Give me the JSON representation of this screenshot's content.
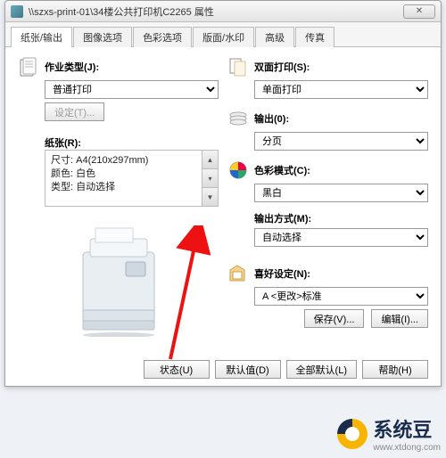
{
  "window": {
    "title": "\\\\szxs-print-01\\34楼公共打印机C2265 属性"
  },
  "tabs": [
    "纸张/输出",
    "图像选项",
    "色彩选项",
    "版面/水印",
    "高级",
    "传真"
  ],
  "left": {
    "jobtype_label": "作业类型(J):",
    "jobtype_value": "普通打印",
    "settings_btn": "设定(T)...",
    "paper_label": "纸张(R):",
    "paper_size_k": "尺寸:",
    "paper_size_v": "A4(210x297mm)",
    "paper_color_k": "颜色:",
    "paper_color_v": "白色",
    "paper_type_k": "类型:",
    "paper_type_v": "自动选择"
  },
  "right": {
    "duplex_label": "双面打印(S):",
    "duplex_value": "单面打印",
    "output_label": "输出(0):",
    "output_value": "分页",
    "color_label": "色彩模式(C):",
    "color_value": "黑白",
    "outmethod_label": "输出方式(M):",
    "outmethod_value": "自动选择",
    "pref_label": "喜好设定(N):",
    "pref_value": "A <更改>标准",
    "save_btn": "保存(V)...",
    "edit_btn": "编辑(I)..."
  },
  "bottom": {
    "status": "状态(U)",
    "defaults": "默认值(D)",
    "alldefaults": "全部默认(L)",
    "help": "帮助(H)"
  },
  "watermark": "系统豆",
  "watermark_url": "www.xtdong.com"
}
